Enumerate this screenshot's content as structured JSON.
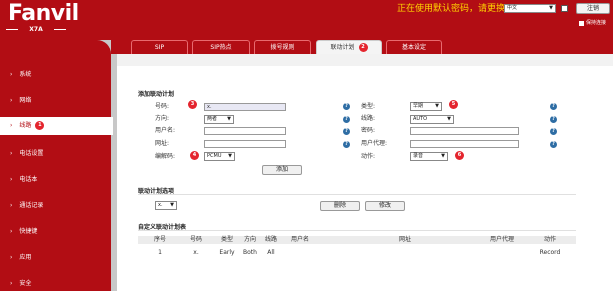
{
  "header": {
    "logo": "Fanvil",
    "model": "X7A",
    "warning": "正在使用默认密码，请更换",
    "language": "中文",
    "logout_label": "注销",
    "keep_login_label": "保持连接"
  },
  "sidebar": {
    "items": [
      {
        "label": "系统",
        "badge": ""
      },
      {
        "label": "网络",
        "badge": ""
      },
      {
        "label": "线路",
        "badge": "1"
      },
      {
        "label": "电话设置",
        "badge": ""
      },
      {
        "label": "电话本",
        "badge": ""
      },
      {
        "label": "通话记录",
        "badge": ""
      },
      {
        "label": "快捷键",
        "badge": ""
      },
      {
        "label": "应用",
        "badge": ""
      },
      {
        "label": "安全",
        "badge": ""
      }
    ]
  },
  "tabs": [
    {
      "label": "SIP"
    },
    {
      "label": "SIP热点"
    },
    {
      "label": "拨号规则"
    },
    {
      "label": "联动计划",
      "badge": "2"
    },
    {
      "label": "基本设定"
    }
  ],
  "add_plan": {
    "title": "添加联动计划",
    "number_label": "号码:",
    "number_value": "x.",
    "direction_label": "方向:",
    "direction_value": "两者",
    "username_label": "用户名:",
    "username_value": "",
    "url_label": "网址:",
    "url_value": "",
    "codec_label": "编解码:",
    "codec_value": "PCMU",
    "type_label": "类型:",
    "type_value": "早期",
    "line_label": "线路:",
    "line_value": "AUTO",
    "password_label": "密码:",
    "password_value": "",
    "proxy_label": "用户代理:",
    "proxy_value": "",
    "action_label": "动作:",
    "action_value": "录音",
    "add_button": "添加",
    "help_glyph": "?",
    "steps": {
      "number": "3",
      "codec": "4",
      "type": "5",
      "action": "6"
    }
  },
  "options": {
    "title": "联动计划选项",
    "select_value": "x.",
    "delete_button": "删除",
    "modify_button": "修改"
  },
  "custom_table": {
    "title": "自定义联动计划表",
    "columns": [
      "序号",
      "号码",
      "类型",
      "方向",
      "线路",
      "用户名",
      "网址",
      "用户代理",
      "动作"
    ],
    "rows": [
      [
        "1",
        "x.",
        "Early",
        "Both",
        "All",
        "",
        "",
        "",
        "Record"
      ]
    ]
  },
  "colors": {
    "brand_red": "#b20d14",
    "badge_red": "#e4252e",
    "help_blue": "#2e6da4",
    "warning_yellow": "#ffd500"
  }
}
